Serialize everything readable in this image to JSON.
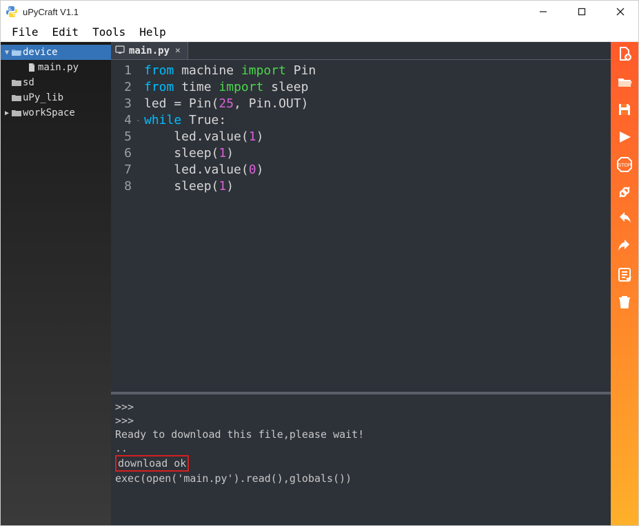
{
  "titlebar": {
    "title": "uPyCraft V1.1"
  },
  "menubar": {
    "items": [
      "File",
      "Edit",
      "Tools",
      "Help"
    ]
  },
  "sidebar": {
    "items": [
      {
        "label": "device",
        "type": "folder-open",
        "selected": true,
        "arrow": "down",
        "indent": 0
      },
      {
        "label": "main.py",
        "type": "file",
        "arrow": "none",
        "indent": 1
      },
      {
        "label": "sd",
        "type": "folder",
        "arrow": "none",
        "indent": 0
      },
      {
        "label": "uPy_lib",
        "type": "folder",
        "arrow": "none",
        "indent": 0
      },
      {
        "label": "workSpace",
        "type": "folder",
        "arrow": "right",
        "indent": 0
      }
    ]
  },
  "tabs": {
    "active": {
      "label": "main.py"
    }
  },
  "editor": {
    "lines": [
      {
        "n": 1,
        "fold": "",
        "tokens": [
          [
            "kw-from",
            "from"
          ],
          [
            "ident",
            " machine "
          ],
          [
            "kw-import",
            "import"
          ],
          [
            "ident",
            " Pin"
          ]
        ]
      },
      {
        "n": 2,
        "fold": "",
        "tokens": [
          [
            "kw-from",
            "from"
          ],
          [
            "ident",
            " time "
          ],
          [
            "kw-import",
            "import"
          ],
          [
            "ident",
            " sleep"
          ]
        ]
      },
      {
        "n": 3,
        "fold": "",
        "tokens": [
          [
            "ident",
            "led "
          ],
          [
            "punct",
            "= "
          ],
          [
            "ident",
            "Pin"
          ],
          [
            "punct",
            "("
          ],
          [
            "num",
            "25"
          ],
          [
            "punct",
            ", "
          ],
          [
            "ident",
            "Pin"
          ],
          [
            "punct",
            "."
          ],
          [
            "ident",
            "OUT"
          ],
          [
            "punct",
            ")"
          ]
        ]
      },
      {
        "n": 4,
        "fold": "-",
        "tokens": [
          [
            "kw-while",
            "while"
          ],
          [
            "ident",
            " True"
          ],
          [
            "punct",
            ":"
          ]
        ]
      },
      {
        "n": 5,
        "fold": "",
        "tokens": [
          [
            "ident",
            "    led"
          ],
          [
            "punct",
            "."
          ],
          [
            "ident",
            "value"
          ],
          [
            "punct",
            "("
          ],
          [
            "num",
            "1"
          ],
          [
            "punct",
            ")"
          ]
        ]
      },
      {
        "n": 6,
        "fold": "",
        "tokens": [
          [
            "ident",
            "    sleep"
          ],
          [
            "punct",
            "("
          ],
          [
            "num",
            "1"
          ],
          [
            "punct",
            ")"
          ]
        ]
      },
      {
        "n": 7,
        "fold": "",
        "tokens": [
          [
            "ident",
            "    led"
          ],
          [
            "punct",
            "."
          ],
          [
            "ident",
            "value"
          ],
          [
            "punct",
            "("
          ],
          [
            "num",
            "0"
          ],
          [
            "punct",
            ")"
          ]
        ]
      },
      {
        "n": 8,
        "fold": "",
        "tokens": [
          [
            "ident",
            "    sleep"
          ],
          [
            "punct",
            "("
          ],
          [
            "num",
            "1"
          ],
          [
            "punct",
            ")"
          ]
        ]
      }
    ]
  },
  "console": {
    "lines": [
      {
        "text": ">>>"
      },
      {
        "text": " "
      },
      {
        "text": ">>>"
      },
      {
        "text": " "
      },
      {
        "text": "Ready to download this file,please wait!"
      },
      {
        "text": ".."
      },
      {
        "text": "download ok",
        "highlight": true
      },
      {
        "text": "exec(open('main.py').read(),globals())"
      }
    ]
  },
  "toolbar": {
    "buttons": [
      "new-file",
      "open-file",
      "save-file",
      "run",
      "stop",
      "connect",
      "undo",
      "redo",
      "syntax-check",
      "delete"
    ]
  }
}
